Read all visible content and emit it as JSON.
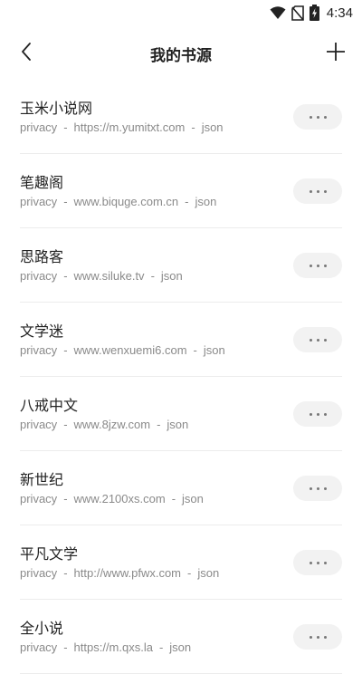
{
  "status": {
    "time": "4:34",
    "icons": [
      "wifi-icon",
      "no-sim-icon",
      "battery-charging-icon"
    ]
  },
  "header": {
    "title": "我的书源",
    "back_icon": "chevron-left-icon",
    "add_icon": "plus-icon"
  },
  "separator": "-",
  "sources": [
    {
      "name": "玉米小说网",
      "type": "privacy",
      "url": "https://m.yumitxt.com",
      "format": "json"
    },
    {
      "name": "笔趣阁",
      "type": "privacy",
      "url": "www.biquge.com.cn",
      "format": "json"
    },
    {
      "name": "思路客",
      "type": "privacy",
      "url": "www.siluke.tv",
      "format": "json"
    },
    {
      "name": "文学迷",
      "type": "privacy",
      "url": "www.wenxuemi6.com",
      "format": "json"
    },
    {
      "name": "八戒中文",
      "type": "privacy",
      "url": "www.8jzw.com",
      "format": "json"
    },
    {
      "name": "新世纪",
      "type": "privacy",
      "url": "www.2100xs.com",
      "format": "json"
    },
    {
      "name": "平凡文学",
      "type": "privacy",
      "url": "http://www.pfwx.com",
      "format": "json"
    },
    {
      "name": "全小说",
      "type": "privacy",
      "url": "https://m.qxs.la",
      "format": "json"
    }
  ]
}
